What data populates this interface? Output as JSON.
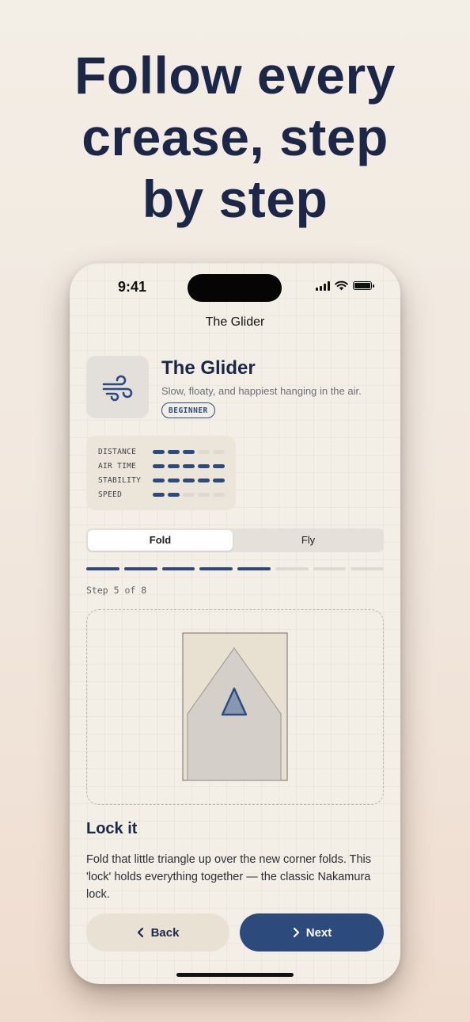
{
  "headline": {
    "line1": "Follow every",
    "line2": "crease, step",
    "line3": "by step"
  },
  "status_bar": {
    "time": "9:41"
  },
  "nav": {
    "title": "The Glider"
  },
  "plane": {
    "name": "The Glider",
    "description": "Slow, floaty, and happiest hanging in the air.",
    "level": "BEGINNER",
    "icon": "wind-icon"
  },
  "stats": [
    {
      "label": "DISTANCE",
      "value": 3,
      "max": 5
    },
    {
      "label": "AIR TIME",
      "value": 5,
      "max": 5
    },
    {
      "label": "STABILITY",
      "value": 5,
      "max": 5
    },
    {
      "label": "SPEED",
      "value": 2,
      "max": 5
    }
  ],
  "mode_tabs": {
    "fold": "Fold",
    "fly": "Fly",
    "selected": "Fold"
  },
  "step": {
    "current": 5,
    "total": 8,
    "label": "Step 5 of 8"
  },
  "instruction": {
    "title": "Lock it",
    "body": "Fold that little triangle up over the new corner folds. This 'lock' holds everything together — the classic Nakamura lock."
  },
  "buttons": {
    "back": "Back",
    "next": "Next"
  },
  "colors": {
    "accent": "#2c4a7c",
    "headline": "#1c2748",
    "background": "#f3efe7"
  }
}
